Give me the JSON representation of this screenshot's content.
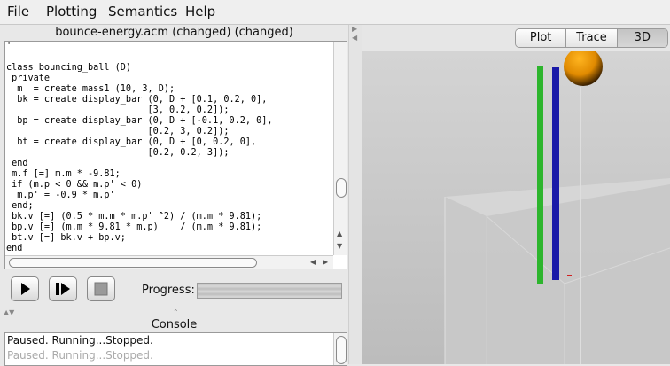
{
  "menu": [
    "File",
    "Plotting",
    "Semantics",
    "Help"
  ],
  "editor": {
    "title": "bounce-energy.acm (changed) (changed)",
    "code_lines": [
      "'",
      "",
      "class bouncing_ball (D)",
      " private",
      "  m  = create mass1 (10, 3, D);",
      "  bk = create display_bar (0, D + [0.1, 0.2, 0],",
      "                          [3, 0.2, 0.2]);",
      "  bp = create display_bar (0, D + [-0.1, 0.2, 0],",
      "                          [0.2, 3, 0.2]);",
      "  bt = create display_bar (0, D + [0, 0.2, 0],",
      "                          [0.2, 0.2, 3]);",
      " end",
      " m.f [=] m.m * -9.81;",
      " if (m.p < 0 && m.p' < 0)",
      "  m.p' = -0.9 * m.p'",
      " end;",
      " bk.v [=] (0.5 * m.m * m.p' ^2) / (m.m * 9.81);",
      " bp.v [=] (m.m * 9.81 * m.p)    / (m.m * 9.81);",
      " bt.v [=] bk.v + bp.v;",
      "end"
    ]
  },
  "progress": {
    "label": "Progress:"
  },
  "console": {
    "title": "Console",
    "lines": [
      "Paused. Running...Stopped.",
      "Paused. Running...Stopped."
    ]
  },
  "view": {
    "tabs": [
      "Plot",
      "Trace",
      "3D"
    ],
    "active_tab": "3D"
  },
  "colors": {
    "green_bar": "#2db52d",
    "blue_bar": "#1a1aa8",
    "ball": "#e89a00",
    "background": "#c6c6c6"
  }
}
